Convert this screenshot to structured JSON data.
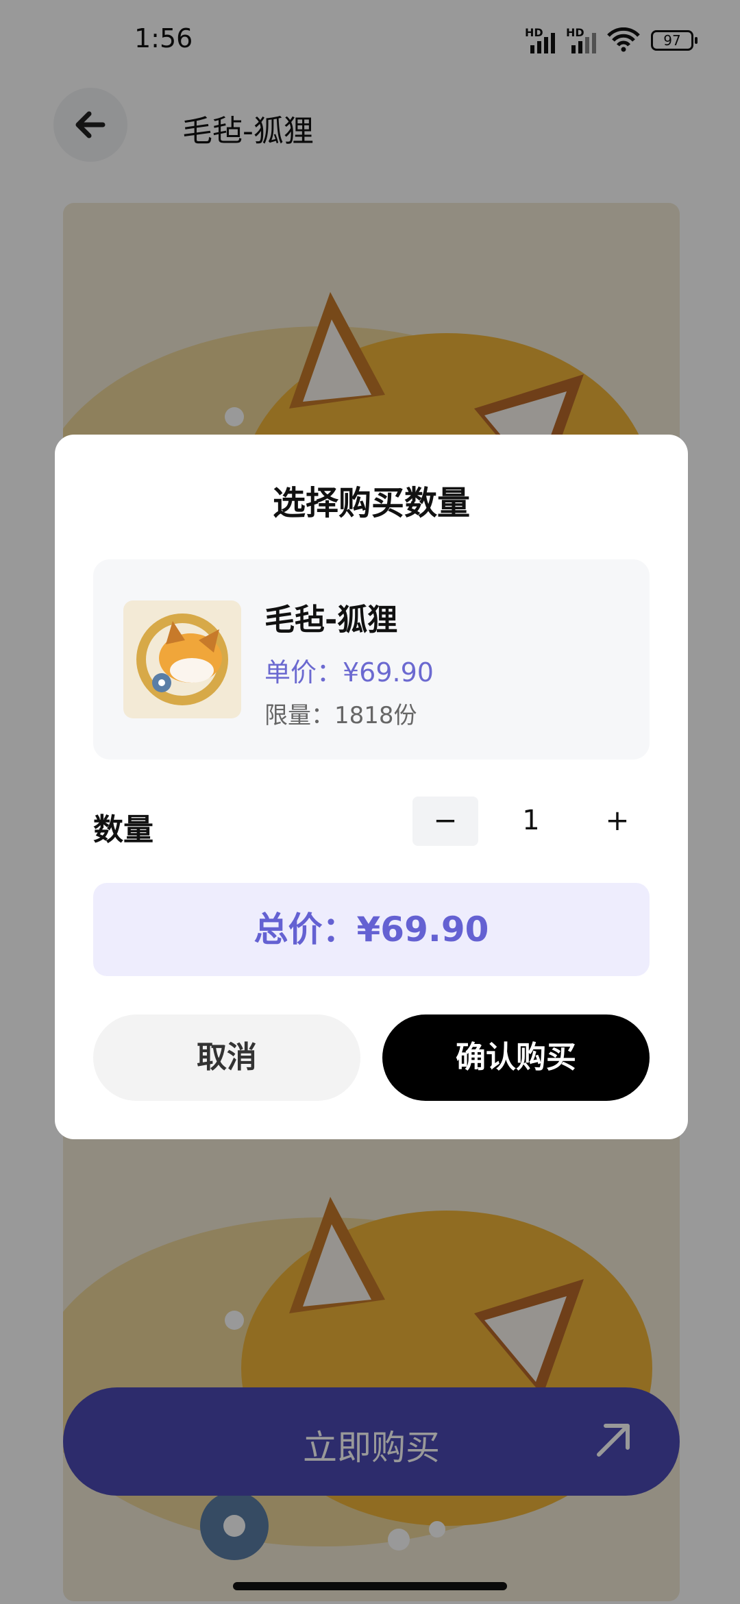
{
  "status_bar": {
    "time": "1:56",
    "signal_1": "HD",
    "signal_2": "HD",
    "wifi_icon": "wifi-icon",
    "battery": "97"
  },
  "header": {
    "title": "毛毡-狐狸",
    "back_icon": "arrow-left-icon"
  },
  "buy_now": {
    "label": "立即购买",
    "icon": "arrow-up-right-icon"
  },
  "dialog": {
    "title": "选择购买数量",
    "product": {
      "name": "毛毡-狐狸",
      "unit_price": "单价：¥69.90",
      "limit": "限量：1818份"
    },
    "quantity": {
      "label": "数量",
      "minus": "−",
      "value": "1",
      "plus": "+"
    },
    "total": "总价：¥69.90",
    "cancel_label": "取消",
    "confirm_label": "确认购买"
  },
  "colors": {
    "accent": "#6461d2",
    "buy_now_bg": "#4b4ab5",
    "confirm_bg": "#000000"
  }
}
